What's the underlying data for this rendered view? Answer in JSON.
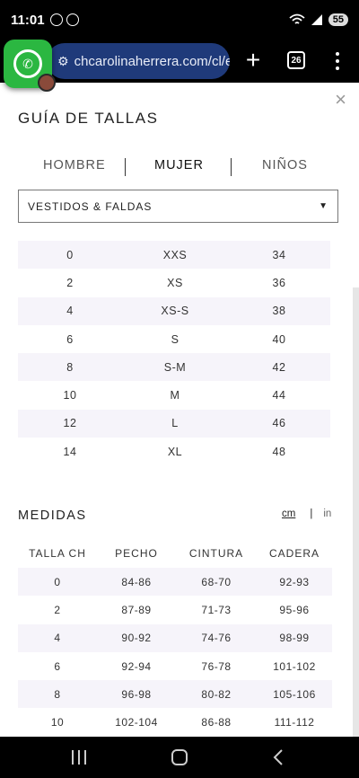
{
  "status_bar": {
    "time": "11:01",
    "battery": "55",
    "icons_left": [
      "whatsapp-icon",
      "messenger-icon"
    ],
    "icons_right": [
      "wifi-icon",
      "signal-icon",
      "battery-icon"
    ]
  },
  "browser": {
    "url": "chcarolinaherrera.com/cl/e",
    "tab_count": "26"
  },
  "modal": {
    "title": "GUÍA DE TALLAS",
    "close": "×",
    "gender_tabs": [
      {
        "label": "HOMBRE",
        "active": false
      },
      {
        "label": "MUJER",
        "active": true
      },
      {
        "label": "NIÑOS",
        "active": false
      }
    ],
    "category": "VESTIDOS & FALDAS",
    "size_rows": [
      [
        "0",
        "XXS",
        "34"
      ],
      [
        "2",
        "XS",
        "36"
      ],
      [
        "4",
        "XS-S",
        "38"
      ],
      [
        "6",
        "S",
        "40"
      ],
      [
        "8",
        "S-M",
        "42"
      ],
      [
        "10",
        "M",
        "44"
      ],
      [
        "12",
        "L",
        "46"
      ],
      [
        "14",
        "XL",
        "48"
      ]
    ],
    "measures_title": "MEDIDAS",
    "unit_cm": "cm",
    "unit_sep": "|",
    "unit_in": "in",
    "measure_headers": [
      "TALLA CH",
      "PECHO",
      "CINTURA",
      "CADERA"
    ],
    "measure_rows": [
      [
        "0",
        "84-86",
        "68-70",
        "92-93"
      ],
      [
        "2",
        "87-89",
        "71-73",
        "95-96"
      ],
      [
        "4",
        "90-92",
        "74-76",
        "98-99"
      ],
      [
        "6",
        "92-94",
        "76-78",
        "101-102"
      ],
      [
        "8",
        "96-98",
        "80-82",
        "105-106"
      ],
      [
        "10",
        "102-104",
        "86-88",
        "111-112"
      ]
    ]
  },
  "colors": {
    "url_pill": "#1f3a7a",
    "row_shade": "#f6f4fa",
    "whatsapp": "#2bb741"
  }
}
